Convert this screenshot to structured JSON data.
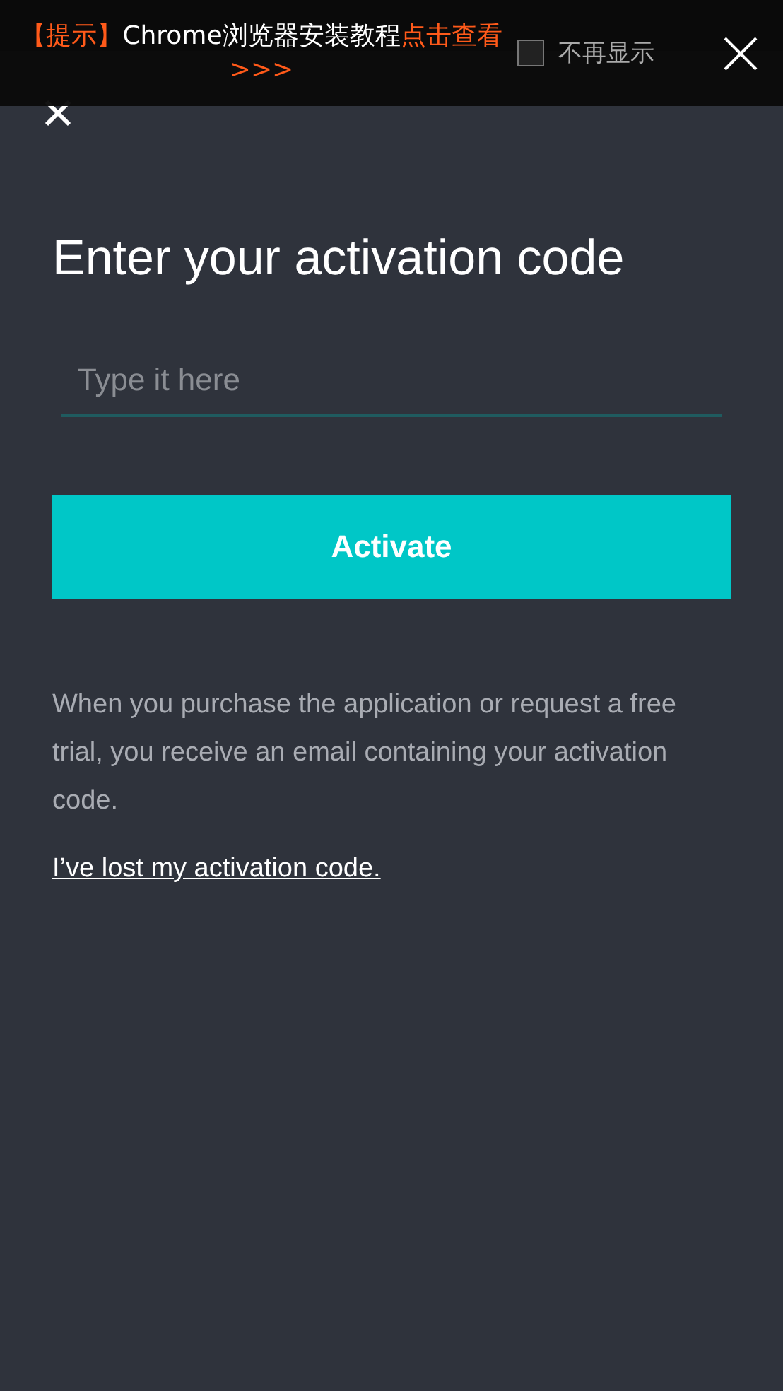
{
  "banner": {
    "segments": [
      {
        "text": "【提示】",
        "highlight": true
      },
      {
        "text": "Chrome浏览器安装教程",
        "highlight": false
      },
      {
        "text": "点击查看>>>",
        "highlight": true
      }
    ],
    "checkbox": {
      "label": "不再显示",
      "checked": false
    }
  },
  "title": "Enter your activation code",
  "field": {
    "placeholder": "Type it here"
  },
  "button": "Activate",
  "description": "When you purchase the application or request a free trial, you receive an email containing your activation code.",
  "link": "I’ve lost my activation code."
}
